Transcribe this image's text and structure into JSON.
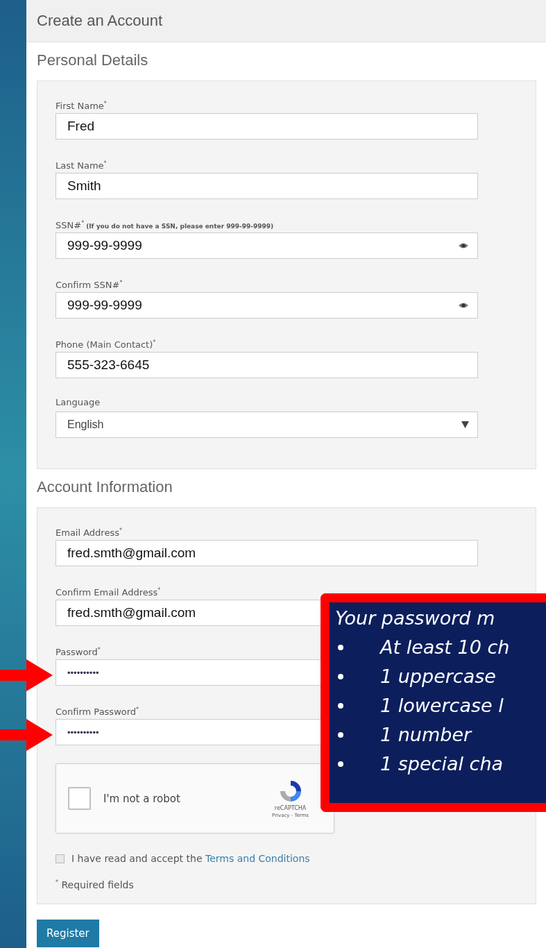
{
  "page_title": "Create an Account",
  "sections": [
    {
      "heading": "Personal Details",
      "fields": [
        {
          "kind": "text",
          "label": "First Name$^{*}$",
          "value": "Fred"
        },
        {
          "kind": "text",
          "label": "Last Name$^{*}$",
          "value": "Smith"
        },
        {
          "kind": "secret",
          "label": "SSN#$^{*}$",
          "note": "(If you do not have a SSN, please enter 999-99-9999)",
          "value": "999-99-9999"
        },
        {
          "kind": "secret",
          "label": "Confirm SSN#$^{*}$",
          "value": "999-99-9999"
        },
        {
          "kind": "text",
          "label": "Phone (Main Contact)$^{*}$",
          "value": "555-323-6645"
        },
        {
          "kind": "select",
          "label": "Language",
          "value": "English"
        }
      ]
    },
    {
      "heading": "Account Information",
      "fields": [
        {
          "kind": "text",
          "label": "Email Address$^{*}$",
          "value": "fred.smth@gmail.com"
        },
        {
          "kind": "text",
          "label": "Confirm Email Address$^{*}$",
          "value": "fred.smth@gmail.com"
        },
        {
          "kind": "password",
          "label": "Password$^{*}$",
          "value": "••••••••••"
        },
        {
          "kind": "password",
          "label": "Confirm Password$^{*}$",
          "value": "••••••••••"
        }
      ],
      "captcha": {
        "checked": false,
        "label": "I'm not a robot",
        "brand": "reCAPTCHA",
        "links": "Privacy - Terms"
      },
      "terms": {
        "checked": false,
        "text": "I have read and accept the ",
        "link": "Terms and Conditions"
      },
      "required_note": "$^{*}$ Required fields"
    }
  ],
  "register_button": "Register",
  "callout": {
    "title": "Your password m",
    "items": [
      "At least 10 ch",
      "1 uppercase",
      "1 lowercase l",
      "1 number",
      "1 special cha"
    ]
  }
}
